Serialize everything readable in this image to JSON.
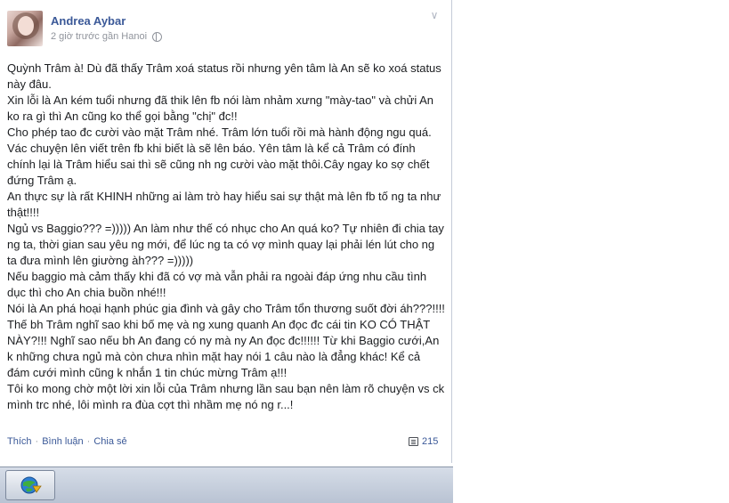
{
  "post": {
    "author": "Andrea Aybar",
    "meta": "2 giờ trước gần Hanoi",
    "paragraphs": [
      "Quỳnh Trâm à! Dù đã thấy Trâm xoá status rồi nhưng yên tâm là An sẽ ko xoá status này đâu.",
      "Xin lỗi là An kém tuổi nhưng đã thik lên fb nói làm nhảm xưng \"mày-tao\" và chửi An ko ra gì thì An cũng ko thể gọi bằng \"chị\" đc!!",
      "Cho phép tao đc cười vào mặt Trâm nhé. Trâm lớn tuổi rồi mà hành động ngu quá. Vác chuyện lên viết trên fb khi biết là sẽ lên báo. Yên tâm là kể cả Trâm có đính chính lại là Trâm hiểu sai thì sẽ cũng nh ng cười vào mặt thôi.Cây ngay ko sợ chết đứng Trâm ạ.",
      "An thực sự là rất KHINH những ai làm trò hay hiểu sai sự thật mà lên fb tố ng ta như thật!!!!",
      "Ngủ vs Baggio??? =))))) An làm như thế có nhục cho An quá ko? Tự nhiên đi chia tay ng ta, thời gian sau yêu ng mới, để lúc ng ta có vợ mình quay lại phải lén lút cho ng ta đưa mình lên giường àh??? =)))))",
      "Nếu baggio mà cảm thấy khi đã có vợ mà vẫn phải ra ngoài đáp ứng nhu cầu tình dục thì cho An chia buồn nhé!!!",
      "Nói là An phá hoại hạnh phúc gia đình và gây cho Trâm tổn thương suốt đời áh???!!!!",
      "Thế bh Trâm nghĩ sao khi bố mẹ và ng xung quanh An đọc đc cái tin KO CÓ THẬT NÀY?!!! Nghĩ sao nếu bh An đang có ny mà ny An đọc đc!!!!!! Từ khi Baggio cưới,An k những chưa ngủ mà còn chưa nhìn mặt hay nói 1 câu nào là đẳng khác! Kể cả đám cưới mình cũng k nhắn 1 tin chúc mừng Trâm ạ!!!",
      "Tôi ko mong chờ một lời xin lỗi của Trâm nhưng lần sau bạn nên làm rõ chuyện vs ck mình trc nhé, lôi mình ra đùa cợt thì nhầm mẹ nó ng r...!"
    ],
    "actions": {
      "like": "Thích",
      "comment": "Bình luận",
      "share": "Chia sẻ",
      "separator": "·"
    },
    "comment_count": "215"
  },
  "icons": {
    "options": "chevron-down-icon",
    "privacy": "globe-icon",
    "comments": "comment-icon",
    "taskbar_app": "idm-globe-icon"
  },
  "colors": {
    "link": "#3b5998",
    "meta": "#90949c"
  }
}
